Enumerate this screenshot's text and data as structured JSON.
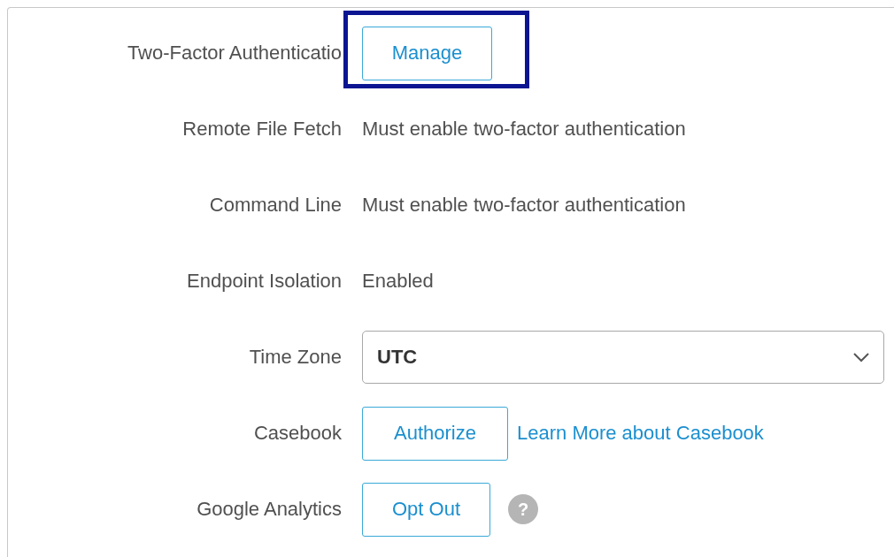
{
  "settings": [
    {
      "kind": "button",
      "label": "Two-Factor Authenticatio",
      "button": "Manage",
      "highlighted": true
    },
    {
      "kind": "text",
      "label": "Remote File Fetch",
      "value": "Must enable two-factor authentication"
    },
    {
      "kind": "text",
      "label": "Command Line",
      "value": "Must enable two-factor authentication"
    },
    {
      "kind": "text",
      "label": "Endpoint Isolation",
      "value": "Enabled"
    },
    {
      "kind": "select",
      "label": "Time Zone",
      "value": "UTC"
    },
    {
      "kind": "button",
      "label": "Casebook",
      "button": "Authorize",
      "link": "Learn More about Casebook"
    },
    {
      "kind": "button",
      "label": "Google Analytics",
      "button": "Opt Out",
      "help": "?"
    }
  ]
}
